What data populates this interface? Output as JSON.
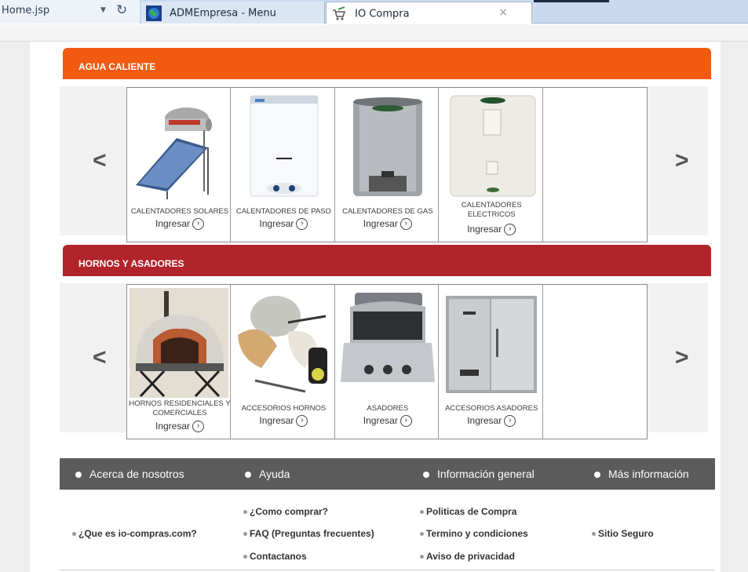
{
  "browser": {
    "address_text": "Home.jsp",
    "tabs": [
      {
        "title": "ADMEmpresa - Menu"
      },
      {
        "title": "IO Compra",
        "close_label": "×"
      }
    ]
  },
  "categories": [
    {
      "title": "AGUA CALIENTE",
      "color": "#f05a11",
      "prev_arrow": "<",
      "next_arrow": ">",
      "items": [
        {
          "caption": "CALENTADORES SOLARES",
          "link": "Ingresar"
        },
        {
          "caption": "CALENTADORES DE PASO",
          "link": "Ingresar"
        },
        {
          "caption": "CALENTADORES DE GAS",
          "link": "Ingresar"
        },
        {
          "caption": "CALENTADORES ELECTRICOS",
          "link": "Ingresar"
        }
      ]
    },
    {
      "title": "HORNOS Y ASADORES",
      "color": "#b1242b",
      "prev_arrow": "<",
      "next_arrow": ">",
      "items": [
        {
          "caption": "HORNOS RESIDENCIALES Y COMERCIALES",
          "link": "Ingresar"
        },
        {
          "caption": "ACCESORIOS HORNOS",
          "link": "Ingresar"
        },
        {
          "caption": "ASADORES",
          "link": "Ingresar"
        },
        {
          "caption": "ACCESORIOS ASADORES",
          "link": "Ingresar"
        }
      ]
    }
  ],
  "footer": {
    "sections": [
      "Acerca de nosotros",
      "Ayuda",
      "Información general",
      "Más información"
    ],
    "about_links": [
      "¿Que es io-compras.com?"
    ],
    "help_links": [
      "¿Como comprar?",
      "FAQ (Preguntas frecuentes)",
      "Contactanos"
    ],
    "info_links": [
      "Politicas de Compra",
      "Termino y condiciones",
      "Aviso de privacidad"
    ],
    "more_links": [
      "Sitio Seguro"
    ]
  }
}
